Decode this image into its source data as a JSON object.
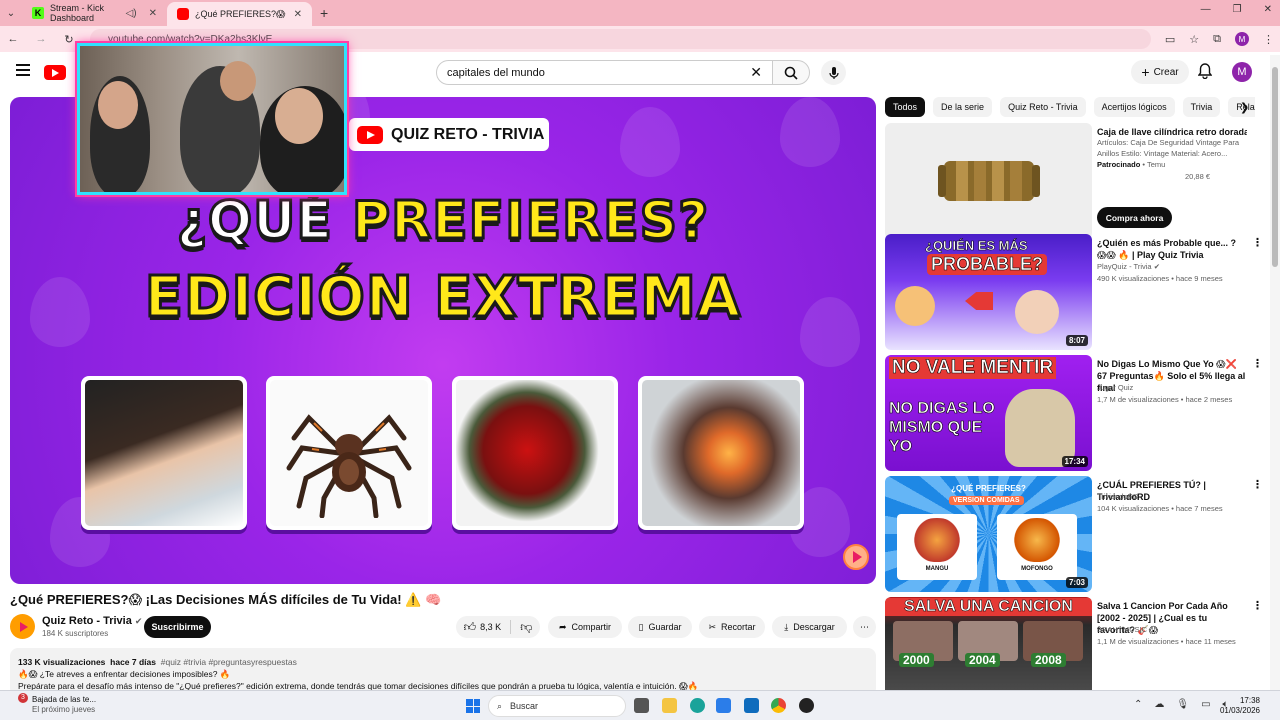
{
  "browser": {
    "tabs": [
      {
        "label": "Stream - Kick Dashboard",
        "favicon": "kick-icon"
      },
      {
        "label": "¿Qué PREFIERES?😱 ¡Las Decisi",
        "favicon": "youtube-icon"
      }
    ],
    "url": "youtube.com/watch?v=DKa2hs3KlvE"
  },
  "youtube": {
    "search_value": "capitales del mundo",
    "create_label": "Crear",
    "avatar_letter": "M"
  },
  "video": {
    "badge": "QUIZ RETO - TRIVIA",
    "line1a": "¿QUÉ ",
    "line1b": "PREFIERES?",
    "line2": "EDICIÓN EXTREMA",
    "title": "¿Qué PREFIERES?😱 ¡Las Decisiones MÁS difíciles de Tu Vida! ⚠️ 🧠",
    "channel": "Quiz Reto - Trivia",
    "subscribers": "184 K suscriptores",
    "subscribe_label": "Suscribirme",
    "likes": "8,3 K",
    "share_label": "Compartir",
    "save_label": "Guardar",
    "clip_label": "Recortar",
    "download_label": "Descargar",
    "views": "133 K visualizaciones",
    "age": "hace 7 días",
    "tags": "#quiz #trivia #preguntasyrespuestas",
    "desc1": "🔥😱 ¿Te atreves a enfrentar decisiones imposibles? 🔥",
    "desc2": "Prepárate para el desafío más intenso de \"¿Qué prefieres?\" edición extrema, donde tendrás que tomar decisiones difíciles que pondrán a prueba tu lógica, valentía e intuición. 😱🔥"
  },
  "chips": [
    "Todos",
    "De la serie",
    "Quiz Reto - Trivia",
    "Acertijos lógicos",
    "Trivia",
    "Rela"
  ],
  "recommendations": [
    {
      "title": "Caja de llave cilíndrica retro dorada...",
      "sub": "Artículos: Caja De Seguridad Vintage Para Anillos Estilo: Vintage Material: Acero...",
      "sponsored": "Patrocinado",
      "store": "Temu",
      "price": "20,88 €",
      "cta": "Compra ahora"
    },
    {
      "title": "¿Quién es más Probable que... ? 😱😱 🔥 | Play Quiz Trivia",
      "channel": "PlayQuiz - Trivia",
      "meta": "490 K visualizaciones • hace 9 meses",
      "duration": "8:07",
      "thumb_text1": "¿QUIÉN ES MÁS",
      "thumb_text2": "PROBABLE?"
    },
    {
      "title": "No Digas Lo Mismo Que Yo 😱❌ 67 Preguntas🔥 Solo el 5% llega al final",
      "channel": "Jugar Quiz",
      "meta": "1,7 M de visualizaciones • hace 2 meses",
      "duration": "17:34",
      "thumb_text1": "NO VALE MENTIR",
      "thumb_text2": "NO DIGAS LO MISMO QUE YO"
    },
    {
      "title": "¿CUÁL PREFIERES TÚ? | TriviandoRD",
      "channel": "TriviandoRD",
      "meta": "104 K visualizaciones • hace 7 meses",
      "duration": "7:03",
      "thumb_text1": "¿QUÉ PREFIERES?",
      "thumb_text2": "VERSION COMIDAS",
      "opt_a": "MANGU",
      "opt_b": "MOFONGO"
    },
    {
      "title": "Salva 1 Cancion Por Cada Año [2002 - 2025] | ¿Cual es tu favorita? 🎸😱",
      "channel": "BRAHYMUSIC",
      "meta": "1,1 M de visualizaciones • hace 11 meses",
      "thumb_text1": "SALVA UNA CANCION",
      "years": [
        "2000",
        "2004",
        "2008"
      ]
    }
  ],
  "taskbar": {
    "news_title": "Bajada de las te...",
    "news_sub": "El próximo jueves",
    "news_badge": "3",
    "search_placeholder": "Buscar",
    "time": "17:38",
    "date": "01/03/2026"
  },
  "colors": {
    "youtube_red": "#ff0000",
    "video_purple": "#9a25e8",
    "title_yellow": "#ffe81a",
    "browser_pink": "#f4b6c2"
  }
}
